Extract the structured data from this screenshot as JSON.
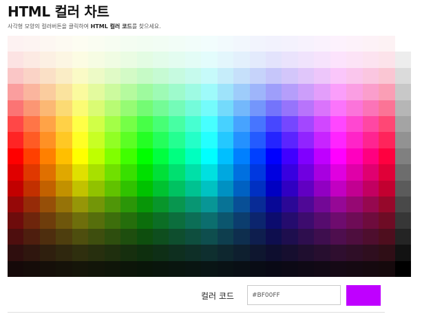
{
  "page": {
    "title": "HTML 컬러 차트",
    "subtitle_pre": "사각형 모양의 컬러버튼을 클릭하여 ",
    "subtitle_bold": "HTML 컬러 코드",
    "subtitle_post": "를 찾으세요."
  },
  "picker": {
    "code_label": "컬러 코드",
    "code_value": "#BF00FF",
    "selected_color": "#BF00FF",
    "grid": {
      "hue_columns": 24,
      "gray_columns": 1,
      "rows": 15
    }
  }
}
